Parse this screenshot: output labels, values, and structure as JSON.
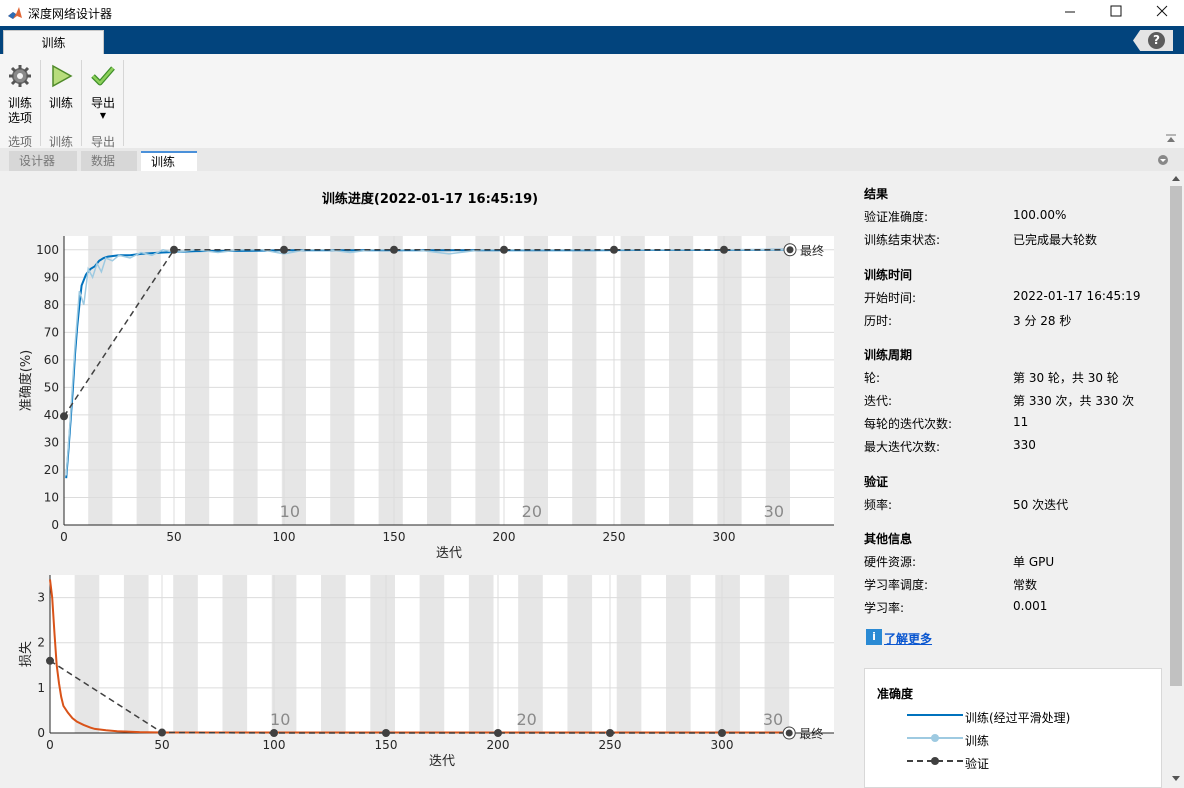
{
  "window": {
    "title": "深度网络设计器",
    "controls": [
      "minimize",
      "maximize",
      "close"
    ]
  },
  "ribbon": {
    "tab": "训练",
    "help_label": "?"
  },
  "toolstrip": {
    "buttons": [
      {
        "label_line1": "训练",
        "label_line2": "选项",
        "icon": "gear-icon"
      },
      {
        "label": "训练",
        "icon": "play-icon"
      },
      {
        "label": "导出",
        "icon": "checkmark-icon",
        "dropdown": "▼"
      }
    ],
    "groups": [
      "选项",
      "训练",
      "导出"
    ]
  },
  "doc_tabs": [
    "设计器",
    "数据",
    "训练"
  ],
  "plot_title": "训练进度(2022-01-17 16:45:19)",
  "accuracy_chart_label": "准确度(%)",
  "loss_chart_label": "损失",
  "xlabel": "迭代",
  "final_label": "最终",
  "epoch_numbers": [
    "10",
    "20",
    "30"
  ],
  "info": {
    "results": {
      "heading": "结果",
      "rows": [
        {
          "k": "验证准确度:",
          "v": "100.00%"
        },
        {
          "k": "训练结束状态:",
          "v": "已完成最大轮数"
        }
      ]
    },
    "time": {
      "heading": "训练时间",
      "rows": [
        {
          "k": "开始时间:",
          "v": "2022-01-17 16:45:19"
        },
        {
          "k": "历时:",
          "v": "3 分 28 秒"
        }
      ]
    },
    "cycle": {
      "heading": "训练周期",
      "rows": [
        {
          "k": "轮:",
          "v": "第 30 轮，共 30 轮"
        },
        {
          "k": "迭代:",
          "v": "第 330 次，共 330 次"
        },
        {
          "k": "每轮的迭代次数:",
          "v": "11"
        },
        {
          "k": "最大迭代次数:",
          "v": "330"
        }
      ]
    },
    "validation": {
      "heading": "验证",
      "rows": [
        {
          "k": "频率:",
          "v": "50 次迭代"
        }
      ]
    },
    "other": {
      "heading": "其他信息",
      "rows": [
        {
          "k": "硬件资源:",
          "v": "单 GPU"
        },
        {
          "k": "学习率调度:",
          "v": "常数"
        },
        {
          "k": "学习率:",
          "v": "0.001"
        }
      ]
    },
    "learn_more": "了解更多"
  },
  "legend": {
    "title": "准确度",
    "entries": [
      "训练(经过平滑处理)",
      "训练",
      "验证"
    ]
  },
  "colors": {
    "train_acc": "#0072bd",
    "train_acc_raw": "#9ecae1",
    "train_loss": "#d95319",
    "validation": "#404040",
    "epoch_shade": "#e6e6e6",
    "ribbon": "#02447d"
  },
  "chart_data": [
    {
      "type": "line",
      "xlabel": "迭代",
      "ylabel": "准确度(%)",
      "xlim": [
        0,
        350
      ],
      "ylim": [
        0,
        105
      ],
      "xticks": [
        0,
        50,
        100,
        150,
        200,
        250,
        300
      ],
      "yticks": [
        0,
        10,
        20,
        30,
        40,
        50,
        60,
        70,
        80,
        90,
        100
      ],
      "epoch_labels": [
        {
          "epoch": 10,
          "iteration": 110
        },
        {
          "epoch": 20,
          "iteration": 220
        },
        {
          "epoch": 30,
          "iteration": 330
        }
      ],
      "series": [
        {
          "name": "训练(经过平滑处理)",
          "x": [
            1,
            2,
            3,
            4,
            5,
            6,
            7,
            8,
            10,
            12,
            14,
            16,
            18,
            20,
            25,
            30,
            35,
            40,
            45,
            50,
            60,
            70,
            80,
            90,
            100,
            120,
            140,
            160,
            180,
            200,
            220,
            240,
            260,
            280,
            300,
            330
          ],
          "y": [
            17,
            27,
            38,
            49,
            62,
            72,
            80,
            87,
            91,
            93,
            94,
            96,
            97,
            97.5,
            98,
            98,
            98.5,
            98.8,
            99,
            99.2,
            99.5,
            99.6,
            99.6,
            99.7,
            99.8,
            99.8,
            99.8,
            99.8,
            99.8,
            99.8,
            99.8,
            99.8,
            99.9,
            99.9,
            99.9,
            100
          ]
        },
        {
          "name": "训练",
          "x": [
            1,
            3,
            5,
            7,
            9,
            11,
            13,
            15,
            17,
            19,
            22,
            25,
            30,
            35,
            40,
            45,
            50,
            60,
            70,
            80,
            90,
            100,
            110,
            120,
            130,
            140,
            150,
            160,
            175,
            190,
            200,
            220,
            250,
            280,
            300,
            330
          ],
          "y": [
            18,
            40,
            65,
            85,
            80,
            93,
            90,
            95,
            92,
            97,
            96,
            98,
            97,
            99,
            98,
            100,
            99,
            100,
            99,
            100,
            100,
            98.5,
            100,
            100,
            99,
            100,
            100,
            100,
            98.5,
            100,
            100,
            100,
            100,
            100,
            100,
            100
          ]
        },
        {
          "name": "验证",
          "x": [
            0,
            50,
            100,
            150,
            200,
            250,
            300,
            330
          ],
          "y": [
            39.5,
            100,
            100,
            100,
            100,
            100,
            100,
            100
          ]
        }
      ]
    },
    {
      "type": "line",
      "xlabel": "迭代",
      "ylabel": "损失",
      "xlim": [
        0,
        350
      ],
      "ylim": [
        0,
        3.5
      ],
      "xticks": [
        0,
        50,
        100,
        150,
        200,
        250,
        300
      ],
      "yticks": [
        0,
        1,
        2,
        3
      ],
      "epoch_labels": [
        {
          "epoch": 10,
          "iteration": 110
        },
        {
          "epoch": 20,
          "iteration": 220
        },
        {
          "epoch": 30,
          "iteration": 330
        }
      ],
      "series": [
        {
          "name": "训练(经过平滑处理)",
          "x": [
            0,
            1,
            2,
            3,
            4,
            5,
            6,
            8,
            10,
            12,
            15,
            18,
            20,
            25,
            30,
            40,
            50,
            60,
            100,
            150,
            200,
            250,
            300,
            330
          ],
          "y": [
            3.4,
            3.0,
            2.2,
            1.5,
            1.1,
            0.8,
            0.6,
            0.45,
            0.33,
            0.25,
            0.18,
            0.12,
            0.09,
            0.06,
            0.04,
            0.02,
            0.01,
            0.01,
            0.01,
            0.01,
            0.01,
            0.01,
            0.01,
            0.01
          ]
        },
        {
          "name": "验证",
          "x": [
            0,
            50,
            100,
            150,
            200,
            250,
            300,
            330
          ],
          "y": [
            1.6,
            0.01,
            0.0,
            0.0,
            0.0,
            0.0,
            0.0,
            0.0
          ]
        }
      ]
    }
  ]
}
